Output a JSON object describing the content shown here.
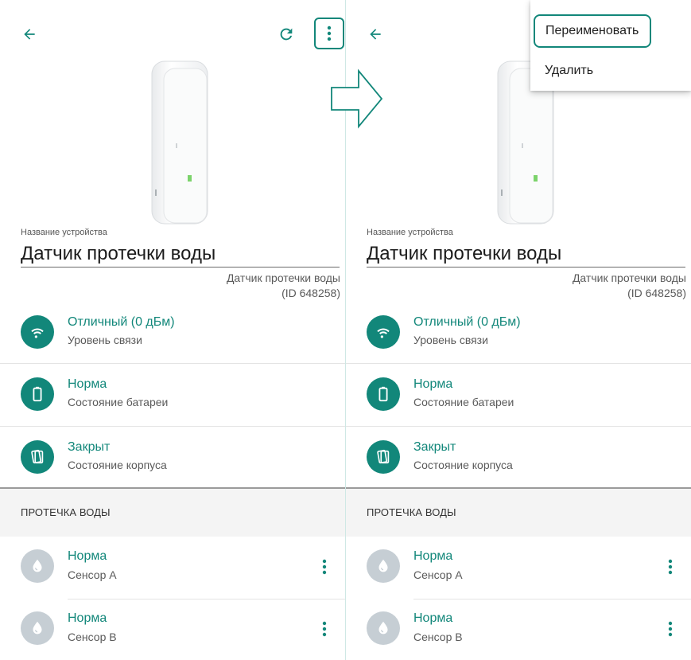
{
  "colors": {
    "accent": "#12877a",
    "sensor_icon_bg": "#c6ced4",
    "section_bg": "#f4f4f4"
  },
  "icons": {
    "back": "arrow-left-icon",
    "refresh": "refresh-icon",
    "more": "more-vertical-icon",
    "signal": "wifi-icon",
    "battery": "battery-icon",
    "case": "case-icon",
    "water": "water-drop-icon"
  },
  "device": {
    "name_caption": "Название устройства",
    "name_value": "Датчик протечки воды",
    "model_line1": "Датчик протечки воды",
    "model_line2": "(ID 648258)"
  },
  "status": [
    {
      "title": "Отличный (0 дБм)",
      "subtitle": "Уровень связи"
    },
    {
      "title": "Норма",
      "subtitle": "Состояние батареи"
    },
    {
      "title": "Закрыт",
      "subtitle": "Состояние корпуса"
    }
  ],
  "section": {
    "title": "ПРОТЕЧКА ВОДЫ"
  },
  "sensors": [
    {
      "title": "Норма",
      "subtitle": "Сенсор А"
    },
    {
      "title": "Норма",
      "subtitle": "Сенсор B"
    }
  ],
  "menu": {
    "items": [
      {
        "label": "Переименовать"
      },
      {
        "label": "Удалить"
      }
    ]
  }
}
